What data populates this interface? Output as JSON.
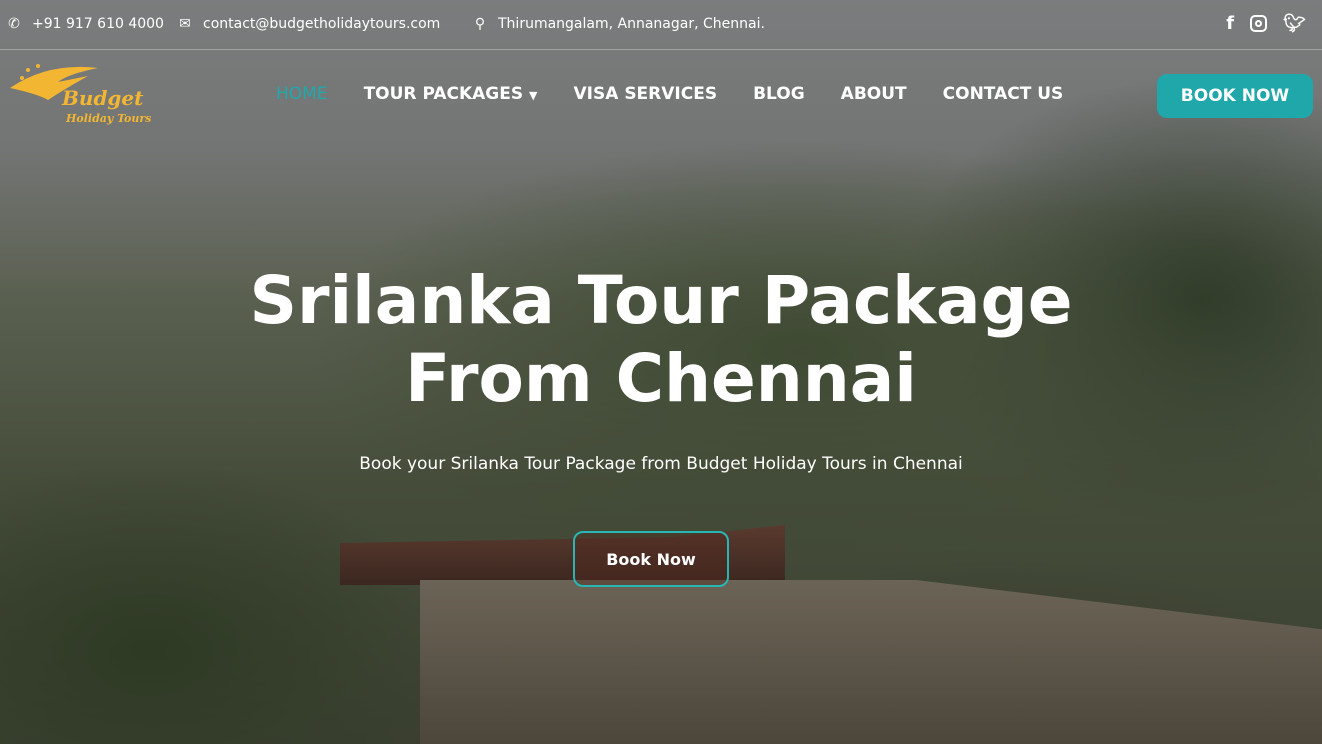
{
  "topbar": {
    "phone": "+91 917 610 4000",
    "email": "contact@budgetholidaytours.com",
    "address": "Thirumangalam, Annanagar, Chennai.",
    "social": [
      "facebook-icon",
      "instagram-icon",
      "twitter-icon"
    ]
  },
  "logo": {
    "line1": "Budget",
    "line2": "Holiday Tours"
  },
  "nav": {
    "items": [
      {
        "label": "HOME"
      },
      {
        "label": "TOUR PACKAGES"
      },
      {
        "label": "VISA SERVICES"
      },
      {
        "label": "BLOG"
      },
      {
        "label": "ABOUT"
      },
      {
        "label": "CONTACT US"
      }
    ],
    "book": "BOOK NOW"
  },
  "hero": {
    "title": "Srilanka Tour Package From Chennai",
    "subtitle": "Book your Srilanka Tour Package from Budget Holiday Tours in Chennai",
    "cta": "Book Now"
  },
  "colors": {
    "accent": "#1fa7aa",
    "logo": "#f2b632"
  }
}
